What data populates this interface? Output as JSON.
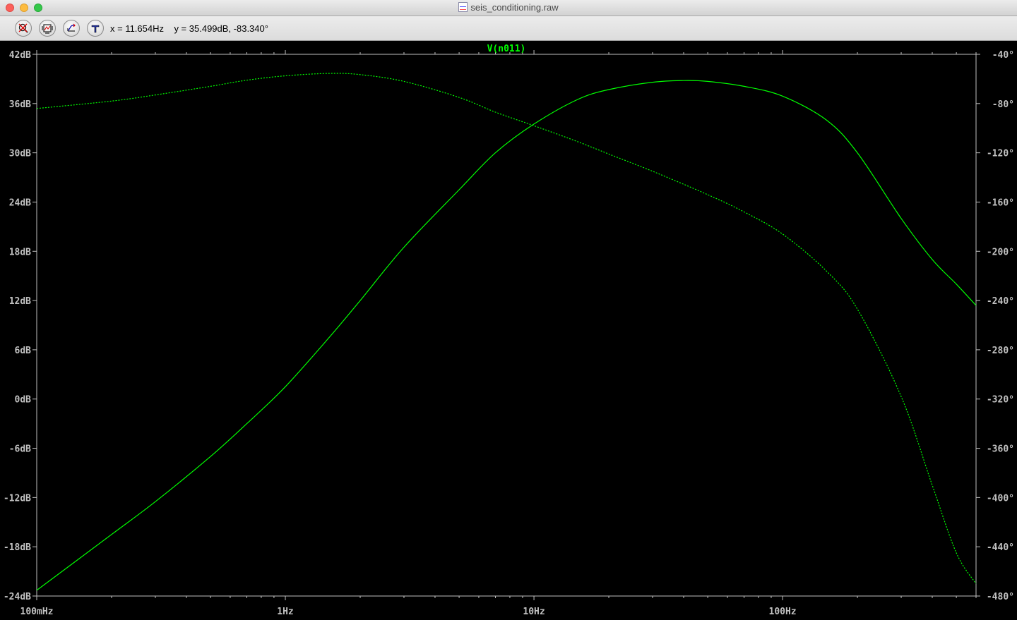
{
  "window": {
    "title": "seis_conditioning.raw"
  },
  "toolbar": {
    "icons": [
      "zoom-out-icon",
      "autorange-icon",
      "pan-icon",
      "probe-icon"
    ],
    "readout": "x = 11.654Hz    y = 35.499dB, -83.340°"
  },
  "colors": {
    "trace": "#00ff00",
    "background": "#000000",
    "axis": "#c0c0c0"
  },
  "chart_data": {
    "type": "line",
    "trace_label": "V(n011)",
    "x_scale": "log",
    "xlim_hz": [
      0.1,
      600
    ],
    "ylim_left_db": [
      -24,
      42
    ],
    "ylim_right_deg": [
      -480,
      -40
    ],
    "x_ticks": [
      {
        "value": 0.1,
        "label": "100mHz"
      },
      {
        "value": 1,
        "label": "1Hz"
      },
      {
        "value": 10,
        "label": "10Hz"
      },
      {
        "value": 100,
        "label": "100Hz"
      }
    ],
    "y_ticks_left": [
      {
        "value": 42,
        "label": "42dB"
      },
      {
        "value": 36,
        "label": "36dB"
      },
      {
        "value": 30,
        "label": "30dB"
      },
      {
        "value": 24,
        "label": "24dB"
      },
      {
        "value": 18,
        "label": "18dB"
      },
      {
        "value": 12,
        "label": "12dB"
      },
      {
        "value": 6,
        "label": "6dB"
      },
      {
        "value": 0,
        "label": "0dB"
      },
      {
        "value": -6,
        "label": "-6dB"
      },
      {
        "value": -12,
        "label": "-12dB"
      },
      {
        "value": -18,
        "label": "-18dB"
      },
      {
        "value": -24,
        "label": "-24dB"
      }
    ],
    "y_ticks_right": [
      {
        "value": -40,
        "label": "-40°"
      },
      {
        "value": -80,
        "label": "-80°"
      },
      {
        "value": -120,
        "label": "-120°"
      },
      {
        "value": -160,
        "label": "-160°"
      },
      {
        "value": -200,
        "label": "-200°"
      },
      {
        "value": -240,
        "label": "-240°"
      },
      {
        "value": -280,
        "label": "-280°"
      },
      {
        "value": -320,
        "label": "-320°"
      },
      {
        "value": -360,
        "label": "-360°"
      },
      {
        "value": -400,
        "label": "-400°"
      },
      {
        "value": -440,
        "label": "-440°"
      },
      {
        "value": -480,
        "label": "-480°"
      }
    ],
    "series": [
      {
        "quantity": "magnitude",
        "axis": "left",
        "style": "solid",
        "x": [
          0.1,
          0.2,
          0.3,
          0.5,
          0.7,
          1.0,
          1.5,
          2.0,
          3.0,
          5.0,
          7.0,
          10,
          15,
          20,
          30,
          40,
          50,
          70,
          100,
          150,
          200,
          300,
          400,
          500,
          600
        ],
        "y": [
          -23.3,
          -16.5,
          -12.5,
          -7.0,
          -3.0,
          1.5,
          7.5,
          12.0,
          18.5,
          25.5,
          30.0,
          33.5,
          36.5,
          37.7,
          38.6,
          38.8,
          38.7,
          38.1,
          36.9,
          34.0,
          30.0,
          22.0,
          17.0,
          14.0,
          11.4
        ]
      },
      {
        "quantity": "phase",
        "axis": "right",
        "style": "dashed",
        "x": [
          0.1,
          0.2,
          0.3,
          0.5,
          0.7,
          1.0,
          1.5,
          2.0,
          3.0,
          5.0,
          7.0,
          10,
          15,
          20,
          30,
          50,
          70,
          100,
          150,
          200,
          300,
          400,
          500,
          600
        ],
        "y": [
          -84,
          -78,
          -73,
          -66,
          -61,
          -57.5,
          -55.5,
          -56.5,
          -62,
          -75,
          -87,
          -98,
          -111,
          -121,
          -135,
          -154,
          -168,
          -186,
          -216,
          -247,
          -318,
          -390,
          -445,
          -470
        ]
      }
    ]
  }
}
